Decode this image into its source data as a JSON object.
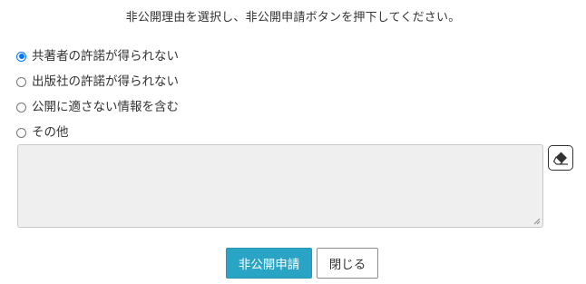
{
  "instruction": "非公開理由を選択し、非公開申請ボタンを押下してください。",
  "reasons": {
    "options": [
      {
        "label": "共著者の許諾が得られない",
        "checked": true
      },
      {
        "label": "出版社の許諾が得られない",
        "checked": false
      },
      {
        "label": "公開に適さない情報を含む",
        "checked": false
      },
      {
        "label": "その他",
        "checked": false
      }
    ]
  },
  "other_text": {
    "value": "",
    "placeholder": ""
  },
  "eraser": {
    "icon": "eraser-icon"
  },
  "buttons": {
    "submit_label": "非公開申請",
    "close_label": "閉じる"
  },
  "colors": {
    "primary_button": "#2aa4c5",
    "radio_checked": "#0075ff",
    "textarea_bg": "#efefef"
  }
}
